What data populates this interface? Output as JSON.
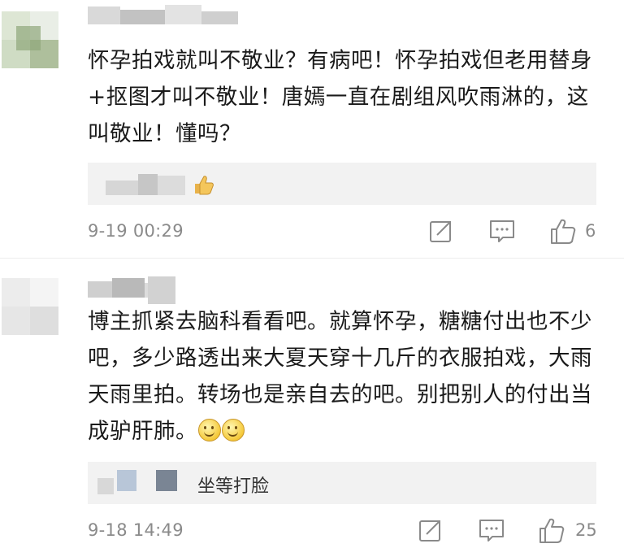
{
  "comments": [
    {
      "text": "怀孕拍戏就叫不敬业？有病吧！怀孕拍戏但老用替身+抠图才叫不敬业！唐嫣一直在剧组风吹雨淋的，这叫敬业！懂吗？",
      "reply_text": "",
      "time": "9-19 00:29",
      "like_count": "6"
    },
    {
      "text": "博主抓紧去脑科看看吧。就算怀孕，糖糖付出也不少吧，多少路透出来大夏天穿十几斤的衣服拍戏，大雨天雨里拍。转场也是亲自去的吧。别把别人的付出当成驴肝肺。",
      "reply_text": "坐等打脸",
      "time": "9-18 14:49",
      "like_count": "25"
    }
  ],
  "icons": {
    "repost": "share-icon",
    "comment": "comment-icon",
    "like": "thumbs-up-icon",
    "emoji": "smile-emoji-icon",
    "reply_like": "thumbs-up-emoji-icon"
  },
  "colors": {
    "text": "#1a1a1a",
    "meta": "#8a8a8a",
    "reply_bg": "#f2f2f2",
    "divider": "#ececec"
  }
}
